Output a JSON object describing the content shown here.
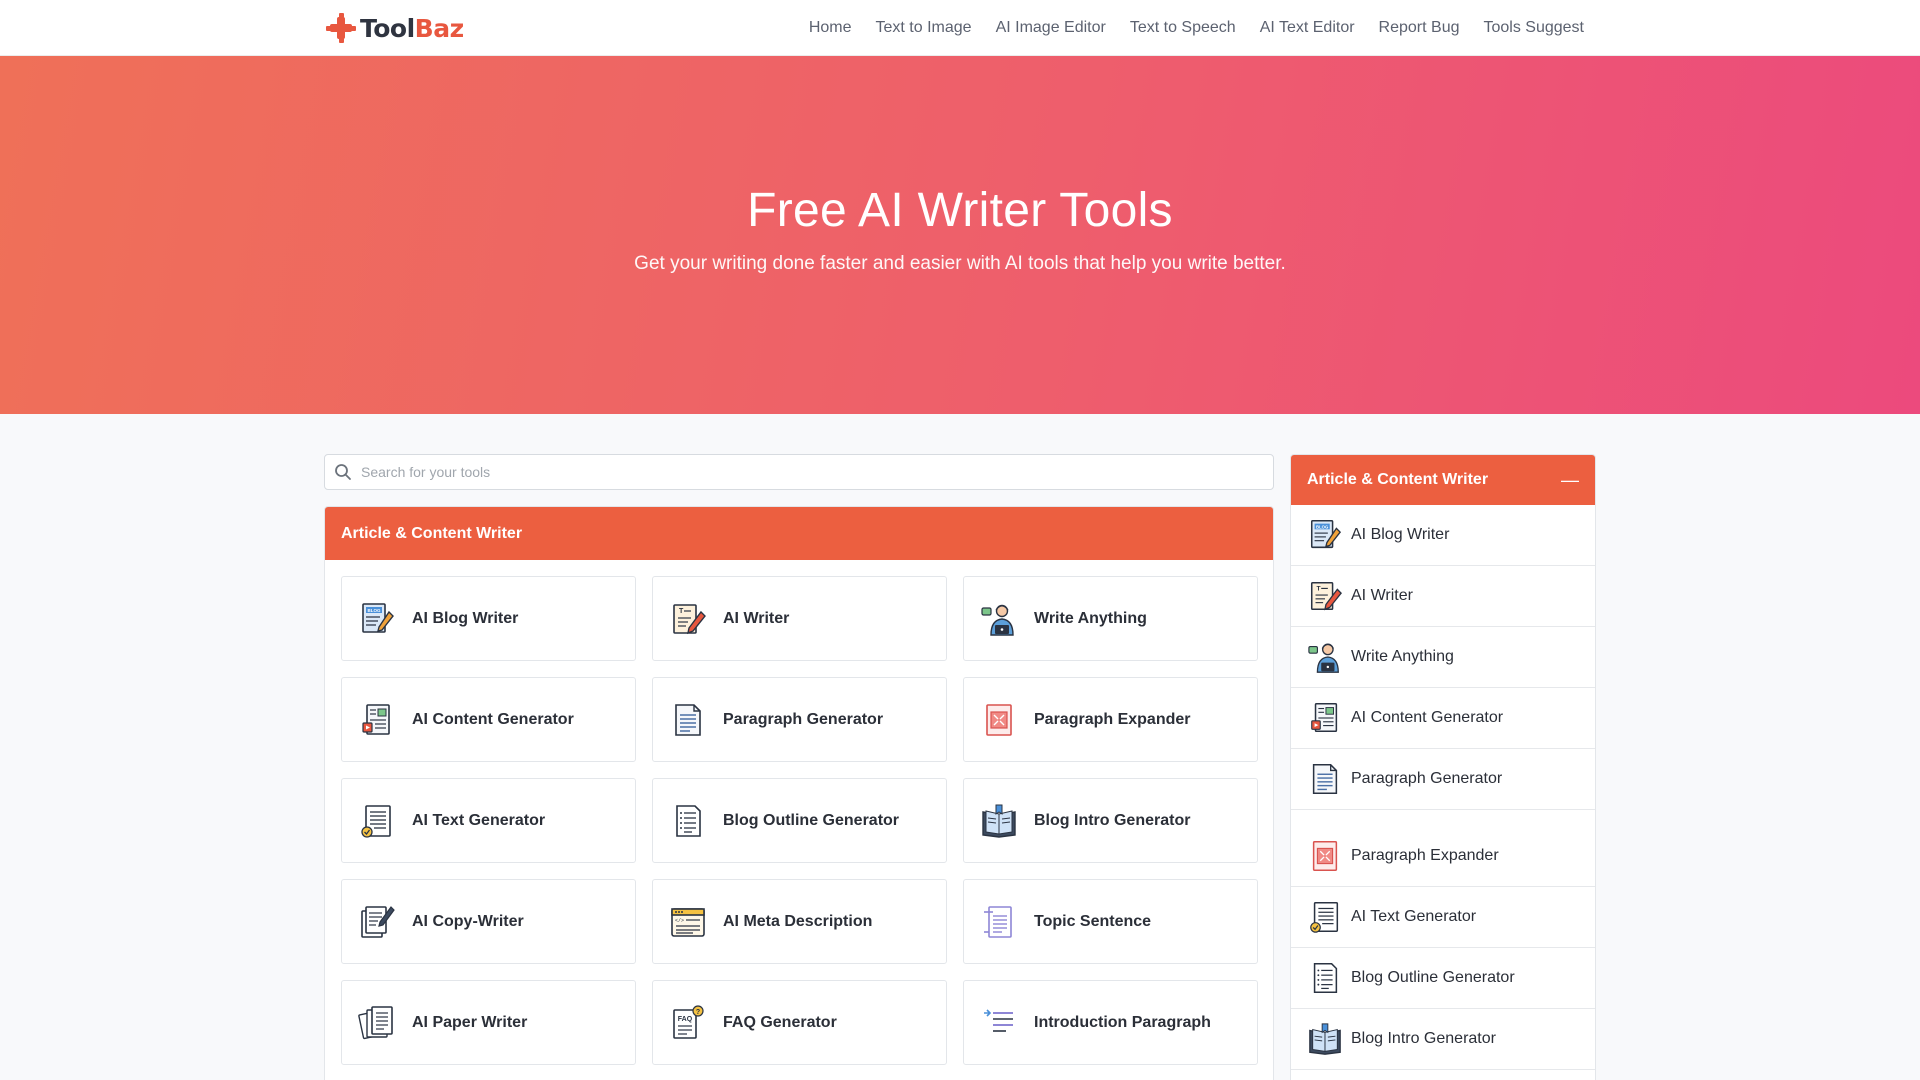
{
  "brand": {
    "name_part1": "Tool",
    "name_part2": "Baz",
    "logo_icon": "toolbaz-plus-logo",
    "accent_color": "#e8573f"
  },
  "nav": {
    "items": [
      {
        "label": "Home"
      },
      {
        "label": "Text to Image"
      },
      {
        "label": "AI Image Editor"
      },
      {
        "label": "Text to Speech"
      },
      {
        "label": "AI Text Editor"
      },
      {
        "label": "Report Bug"
      },
      {
        "label": "Tools Suggest"
      }
    ]
  },
  "hero": {
    "title": "Free AI Writer Tools",
    "subtitle": "Get your writing done faster and easier with AI tools that help you write better.",
    "gradient_start": "#ef7058",
    "gradient_end": "#ec4a7d"
  },
  "search": {
    "placeholder": "Search for your tools",
    "value": "",
    "icon": "search-icon"
  },
  "main": {
    "category_title": "Article & Content Writer",
    "header_color": "#ec5f40",
    "tools": [
      {
        "label": "AI Blog Writer",
        "icon": "blog-writer-icon"
      },
      {
        "label": "AI Writer",
        "icon": "ai-writer-icon"
      },
      {
        "label": "Write Anything",
        "icon": "write-anything-icon"
      },
      {
        "label": "AI Content Generator",
        "icon": "content-generator-icon"
      },
      {
        "label": "Paragraph Generator",
        "icon": "paragraph-generator-icon"
      },
      {
        "label": "Paragraph Expander",
        "icon": "paragraph-expander-icon"
      },
      {
        "label": "AI Text Generator",
        "icon": "text-generator-icon"
      },
      {
        "label": "Blog Outline Generator",
        "icon": "blog-outline-icon"
      },
      {
        "label": "Blog Intro Generator",
        "icon": "blog-intro-icon"
      },
      {
        "label": "AI Copy-Writer",
        "icon": "copywriter-icon"
      },
      {
        "label": "AI Meta Description",
        "icon": "meta-description-icon"
      },
      {
        "label": "Topic Sentence",
        "icon": "topic-sentence-icon"
      },
      {
        "label": "AI Paper Writer",
        "icon": "paper-writer-icon"
      },
      {
        "label": "FAQ Generator",
        "icon": "faq-generator-icon"
      },
      {
        "label": "Introduction Paragraph",
        "icon": "introduction-paragraph-icon"
      }
    ]
  },
  "sidebar": {
    "title": "Article & Content Writer",
    "collapse_symbol": "—",
    "items": [
      {
        "label": "AI Blog Writer",
        "icon": "blog-writer-icon"
      },
      {
        "label": "AI Writer",
        "icon": "ai-writer-icon"
      },
      {
        "label": "Write Anything",
        "icon": "write-anything-icon"
      },
      {
        "label": "AI Content Generator",
        "icon": "content-generator-icon"
      },
      {
        "label": "Paragraph Generator",
        "icon": "paragraph-generator-icon"
      },
      {
        "label": "Paragraph Expander",
        "icon": "paragraph-expander-icon"
      },
      {
        "label": "AI Text Generator",
        "icon": "text-generator-icon"
      },
      {
        "label": "Blog Outline Generator",
        "icon": "blog-outline-icon"
      },
      {
        "label": "Blog Intro Generator",
        "icon": "blog-intro-icon"
      }
    ]
  }
}
